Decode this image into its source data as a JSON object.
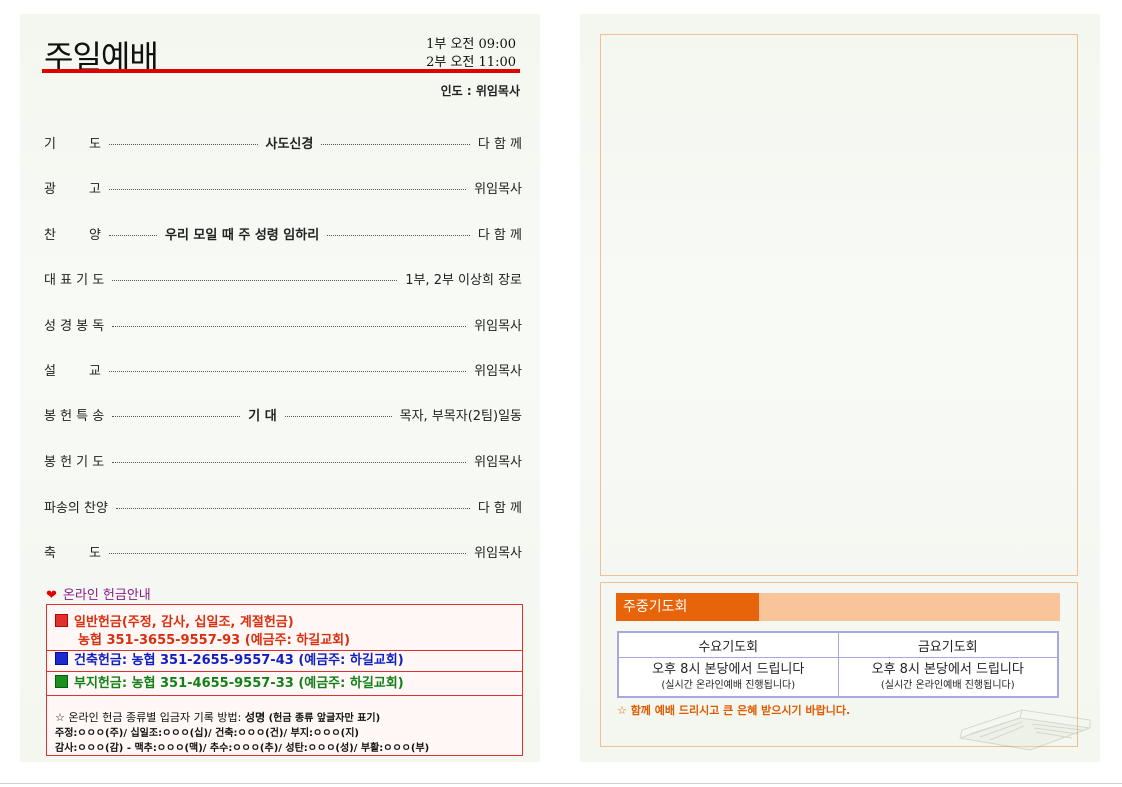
{
  "worship": {
    "title": "주일예배",
    "times": [
      "1부 오전 09:00",
      "2부 오전 11:00"
    ],
    "leader": "인도 : 위임목사"
  },
  "order": [
    {
      "label": "기        도",
      "middle": "사도신경",
      "who": "다 함 께"
    },
    {
      "label": "광        고",
      "middle": "",
      "who": "위임목사"
    },
    {
      "label": "찬        양",
      "middle": "우리 모일 때 주 성령 임하리",
      "who": "다 함 께"
    },
    {
      "label": "대 표 기 도",
      "middle": "",
      "who": "1부, 2부 이상희 장로"
    },
    {
      "label": "성 경 봉 독",
      "middle": "",
      "who": "위임목사"
    },
    {
      "label": "설        교",
      "middle": "",
      "who": "위임목사"
    },
    {
      "label": "봉 헌 특 송",
      "middle": "기 대",
      "who": "목자, 부목자(2팀)일동"
    },
    {
      "label": "봉 헌 기 도",
      "middle": "",
      "who": "위임목사"
    },
    {
      "label": "파송의 찬양",
      "middle": "",
      "who": "다 함 께"
    },
    {
      "label": "축        도",
      "middle": "",
      "who": "위임목사"
    }
  ],
  "offering": {
    "title": "온라인 헌금안내",
    "general_label": "일반헌금(주정, 감사, 십일조, 계절헌금)",
    "general_account": "농협 351-3655-9557-93 (예금주: 하길교회)",
    "building": "건축헌금: 농협 351-2655-9557-43 (예금주: 하길교회)",
    "land": "부지헌금: 농협 351-4655-9557-33 (예금주: 하길교회)",
    "note_intro": "☆ 온라인 헌금 종류별 입금자 기록 방법: ",
    "note_bold": "성명",
    "note_suffix": " (헌금 종류 앞글자만 표기)",
    "note_line2": "주정:ㅇㅇㅇ(주)/ 십일조:ㅇㅇㅇ(십)/ 건축:ㅇㅇㅇ(건)/ 부지:ㅇㅇㅇ(지)",
    "note_line3": "감사:ㅇㅇㅇ(감) - 맥추:ㅇㅇㅇ(맥)/ 추수:ㅇㅇㅇ(추)/ 성탄:ㅇㅇㅇ(성)/ 부활:ㅇㅇㅇ(부)"
  },
  "prayer": {
    "title": "주중기도회",
    "columns": [
      "수요기도회",
      "금요기도회"
    ],
    "main": [
      "오후 8시 본당에서 드립니다",
      "오후 8시 본당에서 드립니다"
    ],
    "sub": [
      "(실시간 온라인예배 진행됩니다)",
      "(실시간 온라인예배 진행됩니다)"
    ],
    "footer": "☆ 함께 예배 드리시고 큰 은혜 받으시기 바랍니다."
  },
  "colors": {
    "rule": "#e00000",
    "offer_border": "#e03030",
    "prayer_tag": "#e8640a",
    "prayer_bar": "#f9c49a"
  }
}
